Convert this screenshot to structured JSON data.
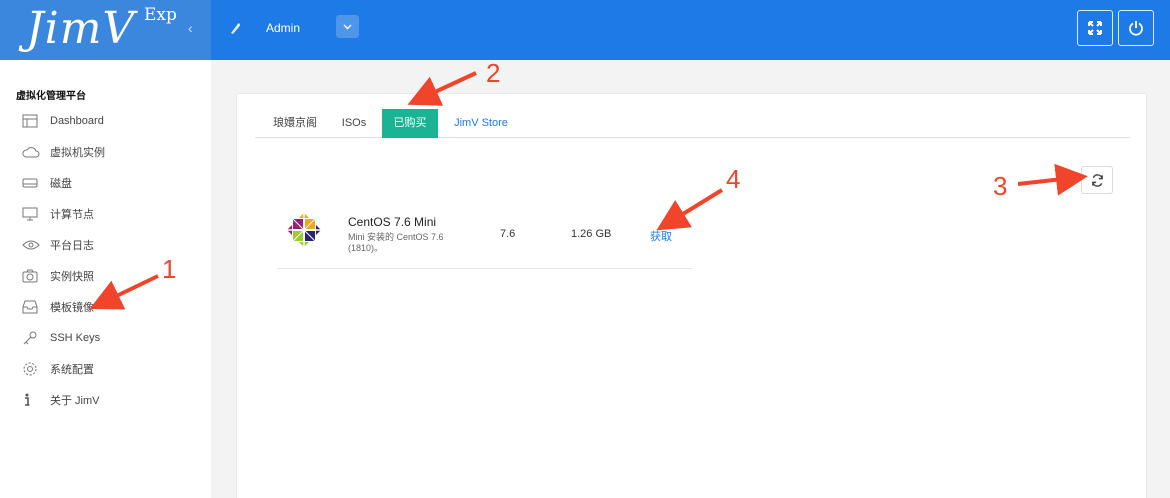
{
  "header": {
    "logo_main": "JimV",
    "logo_sup": "Exp",
    "collapse_icon": "‹",
    "user_name": "Admin",
    "fullscreen_icon": "fullscreen-icon",
    "power_icon": "power-icon"
  },
  "sidebar": {
    "title": "虚拟化管理平台",
    "items": [
      {
        "label": "Dashboard",
        "icon": "dashboard-icon"
      },
      {
        "label": "虚拟机实例",
        "icon": "cloud-icon"
      },
      {
        "label": "磁盘",
        "icon": "disk-icon"
      },
      {
        "label": "计算节点",
        "icon": "monitor-icon"
      },
      {
        "label": "平台日志",
        "icon": "eye-icon"
      },
      {
        "label": "实例快照",
        "icon": "camera-icon"
      },
      {
        "label": "模板镜像",
        "icon": "inbox-icon"
      },
      {
        "label": "SSH Keys",
        "icon": "key-icon"
      },
      {
        "label": "系统配置",
        "icon": "gear-icon"
      },
      {
        "label": "关于 JimV",
        "icon": "info-icon"
      }
    ]
  },
  "tabs": [
    {
      "label": "琅嬛京阁"
    },
    {
      "label": "ISOs"
    },
    {
      "label": "已购买",
      "active": true
    },
    {
      "label": "JimV Store"
    }
  ],
  "templates": [
    {
      "name": "CentOS 7.6 Mini",
      "description": "Mini 安装的 CentOS 7.6 (1810)。",
      "version": "7.6",
      "size": "1.26 GB",
      "action": "获取"
    }
  ],
  "annotations": [
    "1",
    "2",
    "3",
    "4"
  ],
  "colors": {
    "header_bg": "#1e7ae6",
    "active_tab": "#1ab394",
    "link": "#1e7ae6",
    "annotation": "#f0452a"
  }
}
